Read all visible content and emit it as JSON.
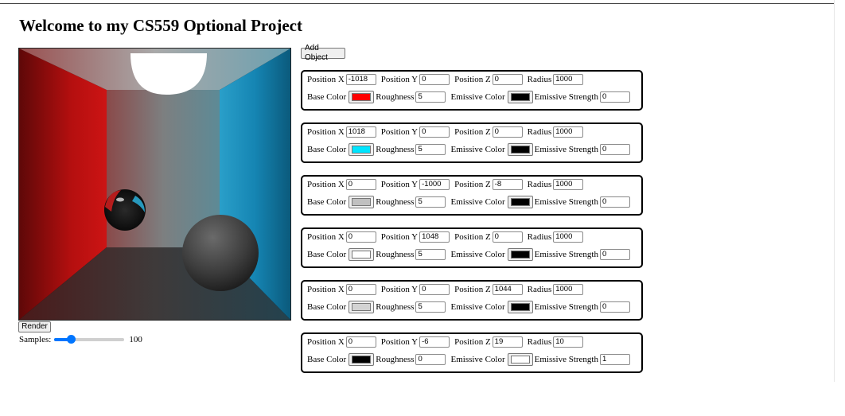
{
  "page": {
    "title": "Welcome to my CS559 Optional Project"
  },
  "controls": {
    "render_label": "Render",
    "samples_label": "Samples:",
    "samples_value": "100",
    "samples_fraction": 0.24,
    "add_object_label": "Add Object"
  },
  "labels": {
    "position_x": "Position X",
    "position_y": "Position Y",
    "position_z": "Position Z",
    "radius": "Radius",
    "base_color": "Base Color",
    "roughness": "Roughness",
    "emissive_color": "Emissive Color",
    "emissive_strength": "Emissive Strength"
  },
  "objects": [
    {
      "position_x": "-1018",
      "position_y": "0",
      "position_z": "0",
      "radius": "1000",
      "base_color": "#ff0000",
      "roughness": "5",
      "emissive_color": "#000000",
      "emissive_strength": "0"
    },
    {
      "position_x": "1018",
      "position_y": "0",
      "position_z": "0",
      "radius": "1000",
      "base_color": "#00e5ff",
      "roughness": "5",
      "emissive_color": "#000000",
      "emissive_strength": "0"
    },
    {
      "position_x": "0",
      "position_y": "-1000",
      "position_z": "-8",
      "radius": "1000",
      "base_color": "#c0c0c0",
      "roughness": "5",
      "emissive_color": "#000000",
      "emissive_strength": "0"
    },
    {
      "position_x": "0",
      "position_y": "1048",
      "position_z": "0",
      "radius": "1000",
      "base_color": "#ffffff",
      "roughness": "5",
      "emissive_color": "#000000",
      "emissive_strength": "0"
    },
    {
      "position_x": "0",
      "position_y": "0",
      "position_z": "1044",
      "radius": "1000",
      "base_color": "#d3d3d3",
      "roughness": "5",
      "emissive_color": "#000000",
      "emissive_strength": "0"
    },
    {
      "position_x": "0",
      "position_y": "-6",
      "position_z": "19",
      "radius": "10",
      "base_color": "#000000",
      "roughness": "0",
      "emissive_color": "#ffffff",
      "emissive_strength": "1"
    }
  ]
}
